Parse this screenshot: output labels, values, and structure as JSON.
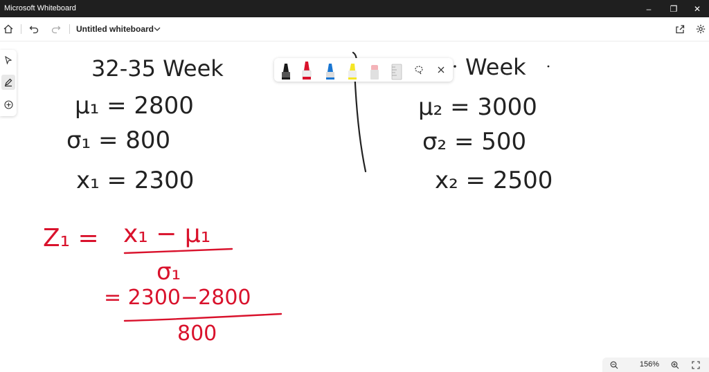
{
  "window": {
    "app_title": "Microsoft Whiteboard",
    "controls": {
      "minimize": "–",
      "restore": "❐",
      "close": "✕"
    }
  },
  "toolbar": {
    "doc_title": "Untitled whiteboard",
    "icons": [
      "home-icon",
      "undo-icon",
      "redo-icon",
      "chevron-down-icon",
      "share-icon",
      "gear-icon"
    ]
  },
  "left_rail": {
    "icons": [
      "select-arrow-icon",
      "pen-icon",
      "add-icon"
    ]
  },
  "pen_tray": {
    "pens": [
      {
        "name": "black-pen",
        "color": "#1a1a1a"
      },
      {
        "name": "red-pen",
        "color": "#d9122c",
        "selected": true
      },
      {
        "name": "blue-pen",
        "color": "#1976d2"
      },
      {
        "name": "highlighter-yellow",
        "color": "#f5e626"
      },
      {
        "name": "eraser",
        "color": "#f4b3b8"
      },
      {
        "name": "ruler",
        "color": "#c8c8c8"
      }
    ],
    "icons": [
      "lasso-icon",
      "close-icon"
    ]
  },
  "ink": {
    "left_header": "32-35 Week",
    "right_header": "Week",
    "mu1": "μ₁ = 2800",
    "sigma1": "σ₁ = 800",
    "x1": "x₁ = 2300",
    "mu2": "μ₂ = 3000",
    "sigma2": "σ₂ = 500",
    "x2": "x₂ = 2500",
    "z1_lhs": "Z₁ =",
    "z1_num": "x₁ − μ₁",
    "z1_den": "σ₁",
    "eq2_num": "= 2300−2800",
    "eq2_den": "800",
    "ink_color": "#222222",
    "red_color": "#d9122c"
  },
  "zoom": {
    "level": "156%",
    "icons": [
      "zoom-out-icon",
      "zoom-in-icon",
      "fit-screen-icon"
    ]
  }
}
